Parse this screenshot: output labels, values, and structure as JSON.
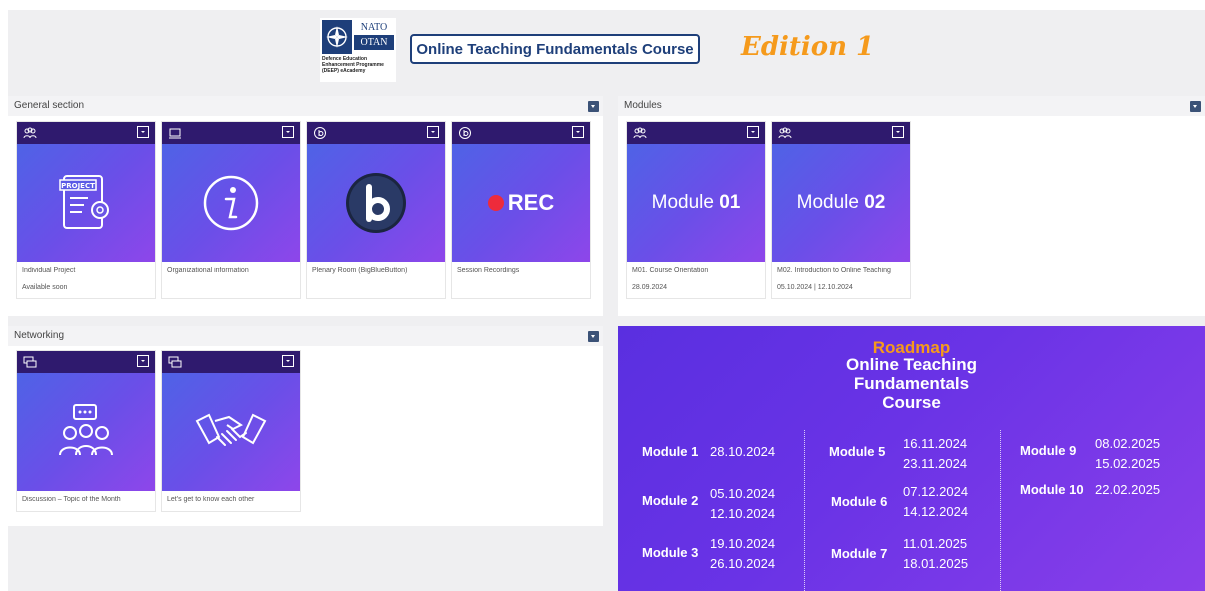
{
  "header": {
    "logo_top": "NATO",
    "logo_bottom": "OTAN",
    "logo_caption": "Defence Education Enhancement Programme (DEEP) eAcademy",
    "course_title": "Online Teaching Fundamentals Course",
    "edition": "Edition 1"
  },
  "general_section": {
    "title": "General section",
    "cards": [
      {
        "title": "Individual Project",
        "sub": "Available soon",
        "icon": "project-doc-icon",
        "bar_icon": "users-icon"
      },
      {
        "title": "Organizational information",
        "sub": "",
        "icon": "info-icon",
        "bar_icon": "laptop-icon"
      },
      {
        "title": "Plenary Room (BigBlueButton)",
        "sub": "",
        "icon": "bigbluebutton-icon",
        "bar_icon": "bbb-small-icon"
      },
      {
        "title": "Session Recordings",
        "sub": "",
        "icon": "rec-icon",
        "image_text": "REC",
        "bar_icon": "bbb-small-icon"
      }
    ]
  },
  "modules_section": {
    "title": "Modules",
    "cards": [
      {
        "image_text_light": "Module",
        "image_text_bold": "01",
        "title": "M01. Course Orientation",
        "sub": "28.09.2024"
      },
      {
        "image_text_light": "Module",
        "image_text_bold": "02",
        "title": "M02. Introduction to Online Teaching",
        "sub": "05.10.2024 | 12.10.2024"
      }
    ]
  },
  "networking_section": {
    "title": "Networking",
    "cards": [
      {
        "title": "Discussion – Topic of the Month",
        "icon": "discussion-group-icon",
        "bar_icon": "forum-icon"
      },
      {
        "title": "Let's get to know each other",
        "icon": "handshake-icon",
        "bar_icon": "forum-icon"
      }
    ]
  },
  "roadmap": {
    "title_line1": "Roadmap",
    "title_line2": "Online Teaching",
    "title_line3": "Fundamentals",
    "title_line4": "Course",
    "modules": [
      {
        "name": "Module 1",
        "dates": [
          "28.10.2024"
        ]
      },
      {
        "name": "Module 2",
        "dates": [
          "05.10.2024",
          "12.10.2024"
        ]
      },
      {
        "name": "Module 3",
        "dates": [
          "19.10.2024",
          "26.10.2024"
        ]
      },
      {
        "name": "Module 5",
        "dates": [
          "16.11.2024",
          "23.11.2024"
        ]
      },
      {
        "name": "Module 6",
        "dates": [
          "07.12.2024",
          "14.12.2024"
        ]
      },
      {
        "name": "Module 7",
        "dates": [
          "11.01.2025",
          "18.01.2025"
        ]
      },
      {
        "name": "Module 9",
        "dates": [
          "08.02.2025",
          "15.02.2025"
        ]
      },
      {
        "name": "Module 10",
        "dates": [
          "22.02.2025"
        ]
      }
    ]
  },
  "colors": {
    "accent_orange": "#f59a1c",
    "nato_blue": "#1e3f7a",
    "card_gradient_start": "#4a66e6",
    "card_gradient_end": "#8e46ea",
    "card_bar": "#2f1a6e",
    "rec_red": "#ee2b3b"
  }
}
